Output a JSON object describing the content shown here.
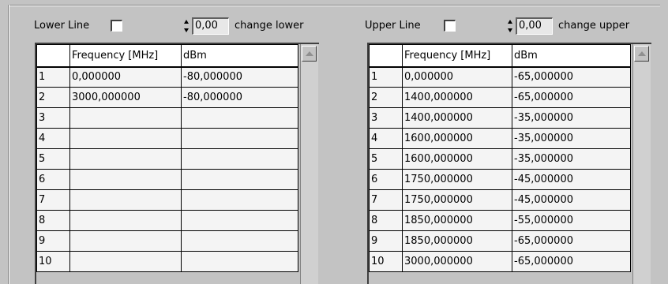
{
  "lower": {
    "line_label": "Lower Line",
    "checked": false,
    "value": "0,00",
    "change_label": "change lower",
    "headers": [
      "",
      "Frequency [MHz]",
      "dBm"
    ],
    "rows": [
      [
        "1",
        "0,000000",
        "-80,000000"
      ],
      [
        "2",
        "3000,000000",
        "-80,000000"
      ],
      [
        "3",
        "",
        ""
      ],
      [
        "4",
        "",
        ""
      ],
      [
        "5",
        "",
        ""
      ],
      [
        "6",
        "",
        ""
      ],
      [
        "7",
        "",
        ""
      ],
      [
        "8",
        "",
        ""
      ],
      [
        "9",
        "",
        ""
      ],
      [
        "10",
        "",
        ""
      ]
    ]
  },
  "upper": {
    "line_label": "Upper Line",
    "checked": false,
    "value": "0,00",
    "change_label": "change upper",
    "headers": [
      "",
      "Frequency [MHz]",
      "dBm"
    ],
    "rows": [
      [
        "1",
        "0,000000",
        "-65,000000"
      ],
      [
        "2",
        "1400,000000",
        "-65,000000"
      ],
      [
        "3",
        "1400,000000",
        "-35,000000"
      ],
      [
        "4",
        "1600,000000",
        "-35,000000"
      ],
      [
        "5",
        "1600,000000",
        "-35,000000"
      ],
      [
        "6",
        "1750,000000",
        "-45,000000"
      ],
      [
        "7",
        "1750,000000",
        "-45,000000"
      ],
      [
        "8",
        "1850,000000",
        "-55,000000"
      ],
      [
        "9",
        "1850,000000",
        "-65,000000"
      ],
      [
        "10",
        "3000,000000",
        "-65,000000"
      ]
    ]
  }
}
